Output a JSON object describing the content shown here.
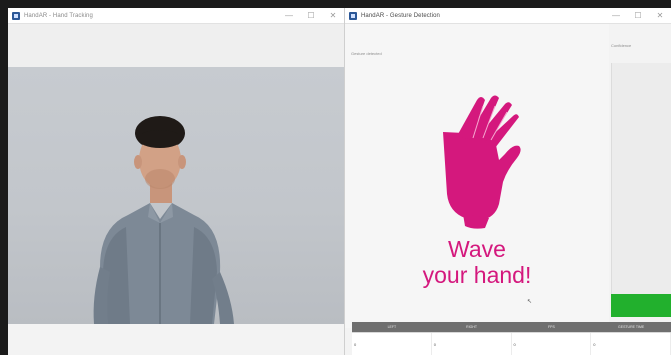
{
  "left_window": {
    "title": "HandAR - Hand Tracking",
    "controls": [
      "—",
      "☐",
      "✕"
    ]
  },
  "right_window": {
    "title": "HandAR - Gesture Detection",
    "left_label": "Gesture detected",
    "right_label": "Confidence",
    "prompt_line1": "Wave",
    "prompt_line2": "your hand!",
    "columns": [
      "LEFT",
      "RIGHT",
      "FPS",
      "GESTURE TIME"
    ],
    "row_values": [
      "0",
      "0",
      "0",
      "0"
    ],
    "controls": [
      "—",
      "☐",
      "✕"
    ]
  },
  "colors": {
    "hand_accent": "#d4187d",
    "status_green": "#22b02d"
  },
  "icons": {
    "hand": "raised-hand-icon",
    "app": "app-icon"
  }
}
